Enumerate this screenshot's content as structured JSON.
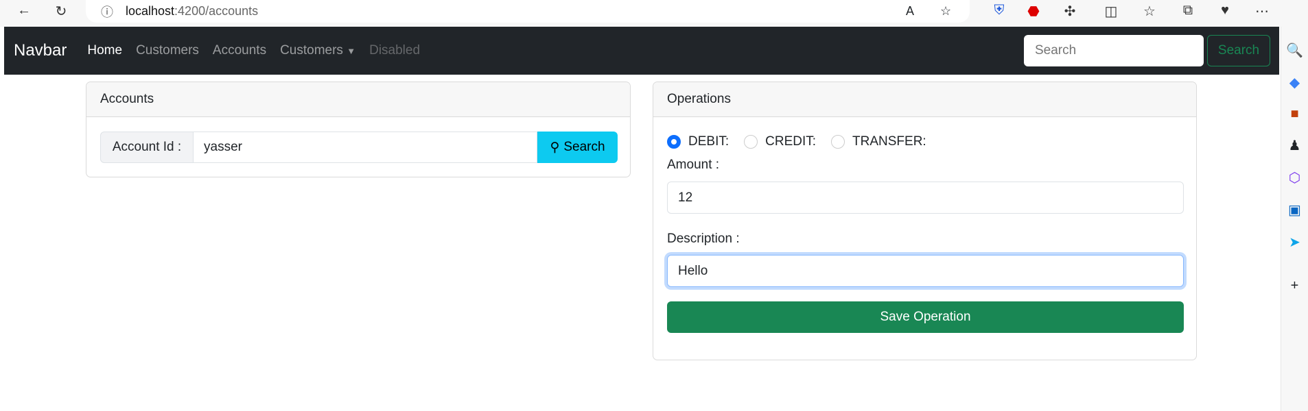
{
  "browser": {
    "url_host": "localhost",
    "url_path": ":4200/accounts"
  },
  "navbar": {
    "brand": "Navbar",
    "links": [
      {
        "label": "Home",
        "state": "active"
      },
      {
        "label": "Customers",
        "state": "normal"
      },
      {
        "label": "Accounts",
        "state": "normal"
      },
      {
        "label": "Customers",
        "state": "dropdown"
      },
      {
        "label": "Disabled",
        "state": "disabled"
      }
    ],
    "search_placeholder": "Search",
    "search_button": "Search"
  },
  "accounts": {
    "title": "Accounts",
    "account_label": "Account Id :",
    "account_value": "yasser",
    "search_button": "Search"
  },
  "operations": {
    "title": "Operations",
    "types": [
      {
        "label": "DEBIT:",
        "checked": true
      },
      {
        "label": "CREDIT:",
        "checked": false
      },
      {
        "label": "TRANSFER:",
        "checked": false
      }
    ],
    "amount_label": "Amount :",
    "amount_value": "12",
    "description_label": "Description :",
    "description_value": "Hello",
    "save_button": "Save Operation"
  },
  "colors": {
    "navbar": "#212529",
    "primary": "#0d6efd",
    "info": "#0dcaf0",
    "success": "#198754"
  }
}
